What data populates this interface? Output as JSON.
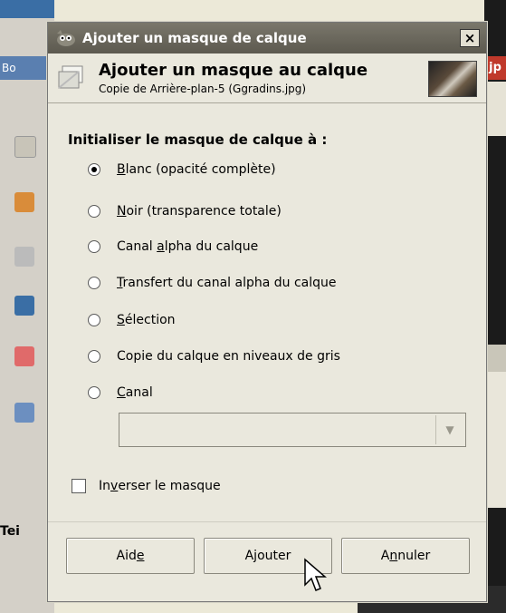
{
  "background": {
    "left_header": "Bo",
    "left_footer": "Tei",
    "right_header": "jp"
  },
  "dialog": {
    "window_title": "Ajouter un masque de calque",
    "close_label": "×",
    "header_title": "Ajouter un masque au calque",
    "header_subtitle": "Copie de Arrière-plan-5 (Ggradins.jpg)",
    "section_label": "Initialiser le masque de calque à :",
    "options": [
      {
        "pre": "",
        "u": "B",
        "post": "lanc (opacité complète)",
        "selected": true
      },
      {
        "pre": "",
        "u": "N",
        "post": "oir (transparence totale)",
        "selected": false
      },
      {
        "pre": "Canal ",
        "u": "a",
        "post": "lpha du calque",
        "selected": false
      },
      {
        "pre": "",
        "u": "T",
        "post": "ransfert du canal alpha du calque",
        "selected": false
      },
      {
        "pre": "",
        "u": "S",
        "post": "élection",
        "selected": false
      },
      {
        "pre": "Copie du calque en niveaux de gris",
        "u": "",
        "post": "",
        "selected": false
      },
      {
        "pre": "",
        "u": "C",
        "post": "anal",
        "selected": false
      }
    ],
    "channel_combo_value": "",
    "invert": {
      "pre": "In",
      "u": "v",
      "post": "erser le masque",
      "checked": false
    },
    "buttons": {
      "help": {
        "pre": "Aid",
        "u": "e",
        "post": ""
      },
      "add": {
        "pre": "Ajouter",
        "u": "",
        "post": ""
      },
      "cancel": {
        "pre": "A",
        "u": "n",
        "post": "nuler"
      }
    }
  },
  "colors": {
    "titlebar": "#6b685d",
    "dialog_bg": "#eae8dd",
    "selection": "#000000"
  }
}
